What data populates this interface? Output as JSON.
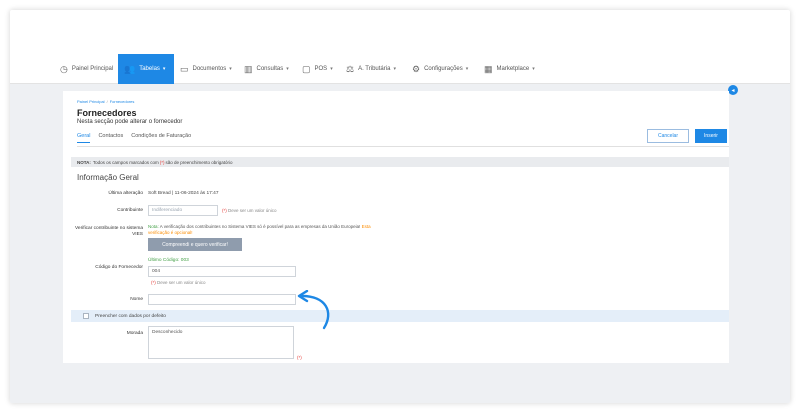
{
  "nav": {
    "items": [
      {
        "label": "Painel Principal",
        "icon": "clock-icon",
        "active": false
      },
      {
        "label": "Tabelas",
        "icon": "users-icon",
        "active": true
      },
      {
        "label": "Documentos",
        "icon": "document-icon",
        "active": false
      },
      {
        "label": "Consultas",
        "icon": "chart-icon",
        "active": false
      },
      {
        "label": "POS",
        "icon": "pos-icon",
        "active": false
      },
      {
        "label": "A. Tributária",
        "icon": "scale-icon",
        "active": false
      },
      {
        "label": "Configurações",
        "icon": "gear-icon",
        "active": false
      },
      {
        "label": "Marketplace",
        "icon": "grid-icon",
        "active": false
      }
    ]
  },
  "breadcrumb": {
    "root": "Painel Principal",
    "current": "Fornecedores"
  },
  "page": {
    "title": "Fornecedores",
    "subtitle": "Nesta secção pode alterar o fornecedor"
  },
  "tabs": [
    "Geral",
    "Contactos",
    "Condições de Faturação"
  ],
  "actions": {
    "cancel": "Cancelar",
    "insert": "Inserir"
  },
  "note": {
    "prefix": "NOTA:",
    "text_before": "Todos os campos marcados com",
    "marker": "(*)",
    "text_after": "são de preenchimento obrigatório"
  },
  "section": {
    "title": "Informação Geral"
  },
  "form": {
    "last_change_label": "Última alteração",
    "last_change_value": "Soft Bread | 11-06-2024 às 17:47",
    "taxpayer_label": "Contribuinte",
    "taxpayer_placeholder": "Indiferenciado",
    "unique_marker": "(*)",
    "unique_hint": "Deve ser um valor único",
    "vies_label": "Verificar contribuinte no sistema VIES",
    "vies_note_prefix": "Nota:",
    "vies_note_text": "A verificação dos contribuintes no Sistema VIES só é possível para as empresas da União Europeia!",
    "vies_note_optional": "Esta verificação é opcional!",
    "vies_button": "Compreendi e quero verificar!",
    "code_label": "Código do Fornecedor",
    "last_code": "Último Código: 003",
    "code_value": "004",
    "name_label": "Nome",
    "name_value": "",
    "prefill_label": "Preencher com dados por defeito",
    "address_label": "Morada",
    "address_value": "Desconhecido",
    "address_marker": "(*)"
  },
  "colors": {
    "accent": "#1e88e5",
    "success": "#43a047",
    "warning": "#fb8c00",
    "required": "#e53935"
  }
}
